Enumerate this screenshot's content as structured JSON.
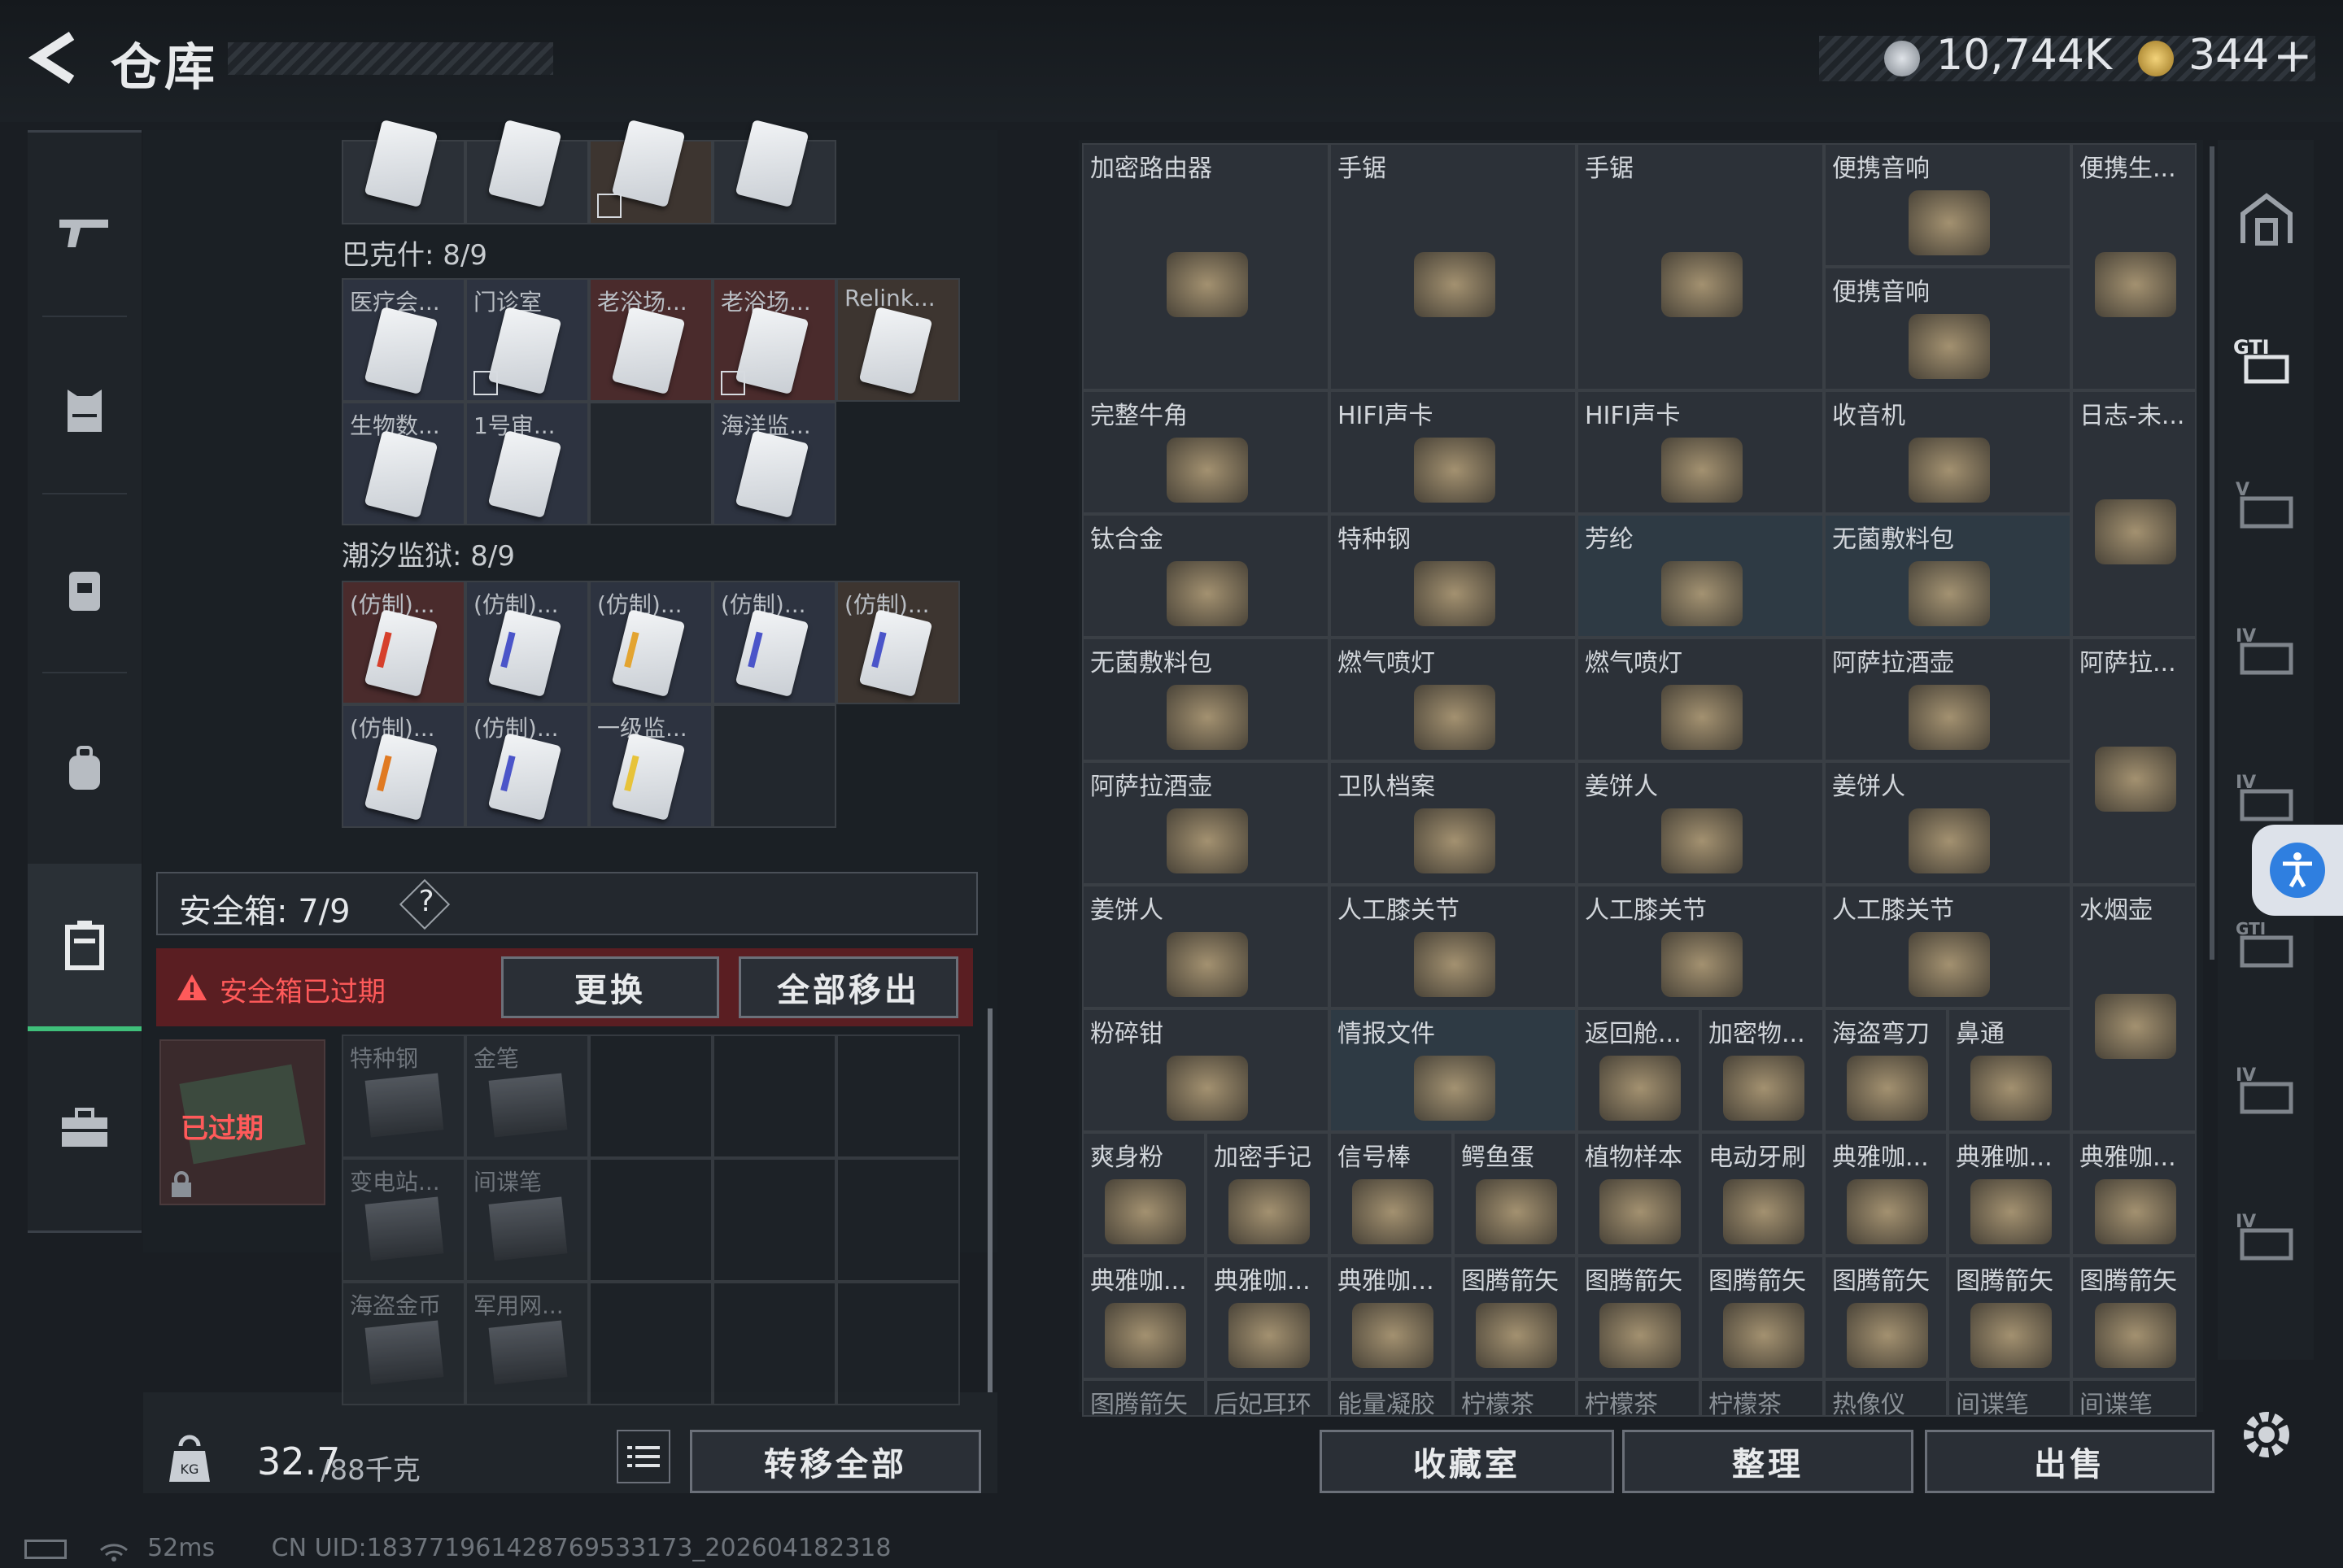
{
  "header": {
    "title": "仓库",
    "currency_silver": "10,744K",
    "currency_gold": "344",
    "gold_plus": "+"
  },
  "left_nav": [
    {
      "name": "weapon-nav",
      "icon": "gun-icon"
    },
    {
      "name": "armor-nav",
      "icon": "armor-icon"
    },
    {
      "name": "vest-nav",
      "icon": "vest-icon"
    },
    {
      "name": "backpack-nav",
      "icon": "backpack-icon"
    },
    {
      "name": "safebox-nav",
      "icon": "safebox-icon",
      "active": true
    },
    {
      "name": "briefcase-nav",
      "icon": "briefcase-icon"
    }
  ],
  "stash": {
    "sections": [
      {
        "label": "巴克什: 8/9"
      },
      {
        "label": "潮汐监狱: 8/9"
      }
    ],
    "top_row": [
      "",
      "",
      "",
      ""
    ],
    "bakesh_items": [
      [
        "医疗会...",
        "门诊室",
        "老浴场...",
        "老浴场...",
        "Relink..."
      ],
      [
        "生物数...",
        "1号审...",
        "",
        "海洋监...",
        ""
      ]
    ],
    "tide_items": [
      [
        "(仿制)...",
        "(仿制)...",
        "(仿制)...",
        "(仿制)...",
        "(仿制)..."
      ],
      [
        "(仿制)...",
        "(仿制)...",
        "一级监...",
        "",
        ""
      ]
    ]
  },
  "safebox": {
    "title": "安全箱: 7/9",
    "help": "?",
    "expired_notice": "安全箱已过期",
    "replace_btn": "更换",
    "remove_all_btn": "全部移出",
    "expired_badge": "已过期",
    "items": [
      "特种钢",
      "金笔",
      "变电站...",
      "间谍笔",
      "海盗金币",
      "军用网..."
    ]
  },
  "weight": {
    "current": "32.7",
    "max": "/88千克",
    "unit_icon": "KG"
  },
  "transfer_all": "转移全部",
  "inventory": {
    "items": [
      "加密路由器",
      "手锯",
      "手锯",
      "便携音响",
      "便携生...",
      "便携音响",
      "完整牛角",
      "HIFI声卡",
      "HIFI声卡",
      "收音机",
      "日志-未...",
      "钛合金",
      "特种钢",
      "芳纶",
      "无菌敷料包",
      "无菌敷料包",
      "燃气喷灯",
      "燃气喷灯",
      "阿萨拉酒壶",
      "阿萨拉...",
      "阿萨拉酒壶",
      "卫队档案",
      "姜饼人",
      "姜饼人",
      "姜饼人",
      "人工膝关节",
      "人工膝关节",
      "人工膝关节",
      "水烟壶",
      "粉碎钳",
      "情报文件",
      "返回舱...",
      "加密物...",
      "海盗弯刀",
      "鼻通",
      "爽身粉",
      "加密手记",
      "信号棒",
      "鳄鱼蛋",
      "植物样本",
      "电动牙刷",
      "典雅咖...",
      "典雅咖...",
      "典雅咖...",
      "典雅咖...",
      "典雅咖...",
      "典雅咖...",
      "图腾箭矢",
      "图腾箭矢",
      "图腾箭矢",
      "图腾箭矢",
      "图腾箭矢",
      "图腾箭矢",
      "图腾箭矢",
      "后妃耳环",
      "能量凝胶",
      "柠檬茶",
      "柠檬茶",
      "柠檬茶",
      "热像仪",
      "间谍笔",
      "间谍笔"
    ]
  },
  "bottom_buttons": {
    "collection": "收藏室",
    "sort": "整理",
    "sell": "出售"
  },
  "status": {
    "ping": "52ms",
    "uid": "CN UID:18377196142876953317​3_202604182318"
  },
  "colors": {
    "accent_green": "#3fbf7a",
    "expired_red": "#ff5a5a",
    "access_blue": "#2f7fe0"
  }
}
